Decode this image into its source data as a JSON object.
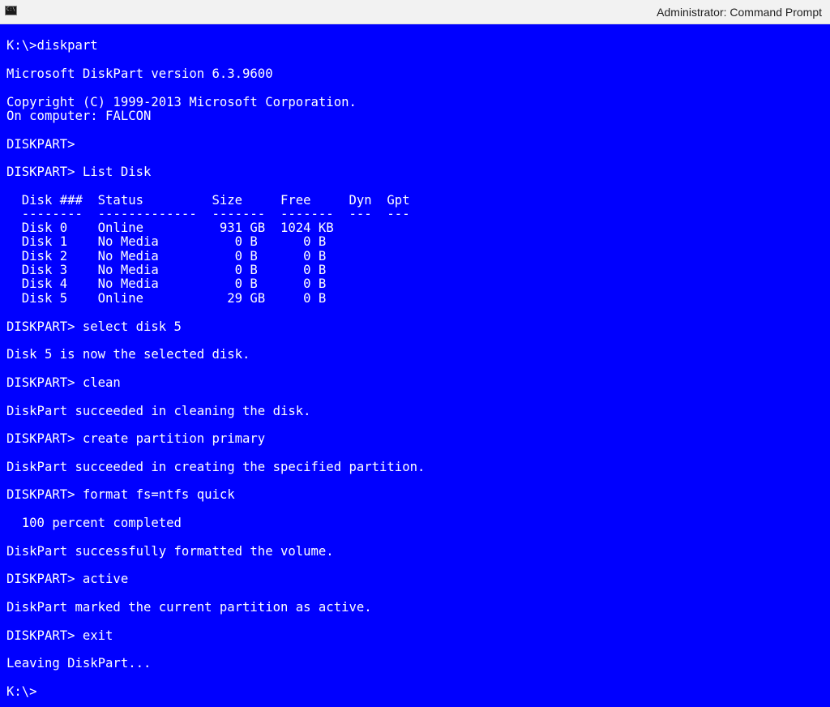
{
  "window": {
    "title": "Administrator: Command Prompt",
    "icon": "cmd-icon",
    "icon_glyph": "C:\\",
    "colors": {
      "console_background": "#0000ff",
      "console_text": "#ffffff",
      "titlebar_background": "#f2f2f2"
    }
  },
  "console": {
    "lines": [
      "K:\\>diskpart",
      "Microsoft DiskPart version 6.3.9600",
      "Copyright (C) 1999-2013 Microsoft Corporation.",
      "On computer: FALCON",
      "DISKPART>",
      "DISKPART> List Disk",
      "  Disk ###  Status         Size     Free     Dyn  Gpt",
      "  --------  -------------  -------  -------  ---  ---",
      "  Disk 0    Online          931 GB  1024 KB",
      "  Disk 1    No Media          0 B      0 B",
      "  Disk 2    No Media          0 B      0 B",
      "  Disk 3    No Media          0 B      0 B",
      "  Disk 4    No Media          0 B      0 B",
      "  Disk 5    Online           29 GB     0 B",
      "DISKPART> select disk 5",
      "Disk 5 is now the selected disk.",
      "DISKPART> clean",
      "DiskPart succeeded in cleaning the disk.",
      "DISKPART> create partition primary",
      "DiskPart succeeded in creating the specified partition.",
      "DISKPART> format fs=ntfs quick",
      "  100 percent completed",
      "DiskPart successfully formatted the volume.",
      "DISKPART> active",
      "DiskPart marked the current partition as active.",
      "DISKPART> exit",
      "Leaving DiskPart...",
      "K:\\>"
    ]
  }
}
